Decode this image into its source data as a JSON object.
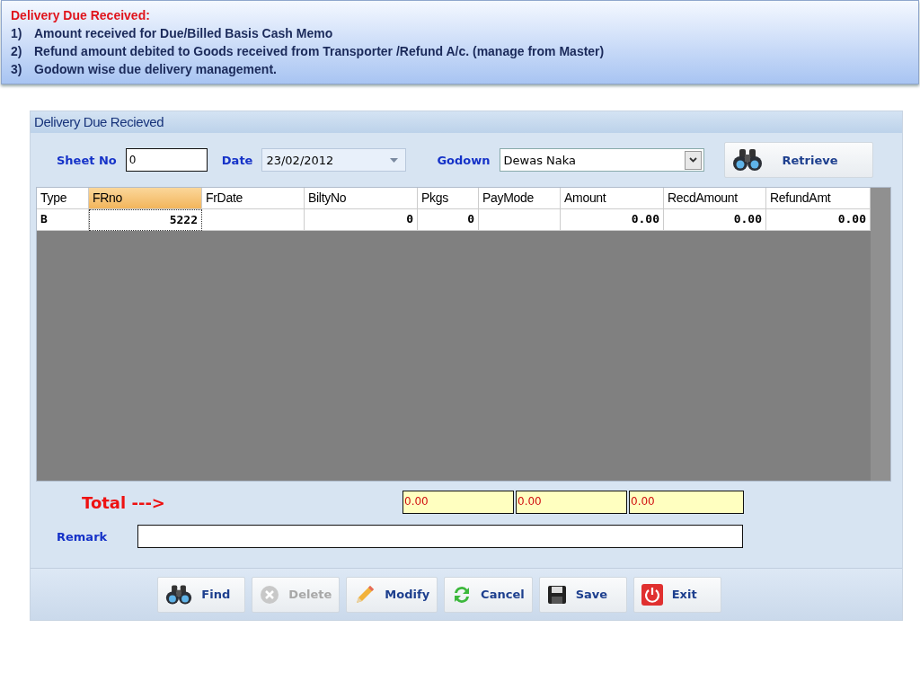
{
  "notes": {
    "title": "Delivery Due Received:",
    "items": [
      {
        "number": "1)",
        "text": "Amount received for Due/Billed Basis Cash Memo"
      },
      {
        "number": "2)",
        "text": "Refund amount debited to Goods received from Transporter /Refund A/c. (manage from Master)"
      },
      {
        "number": "3)",
        "text": "Godown wise  due delivery management."
      }
    ]
  },
  "window": {
    "title": "Delivery Due Recieved"
  },
  "form": {
    "sheet_no": {
      "label": "Sheet No",
      "value": "0"
    },
    "date": {
      "label": "Date",
      "value": "23/02/2012"
    },
    "godown": {
      "label": "Godown",
      "value": "Dewas Naka"
    },
    "retrieve_button": {
      "label": "Retrieve"
    }
  },
  "table": {
    "columns": [
      {
        "label": "Type",
        "selected": false
      },
      {
        "label": "FRno",
        "selected": true
      },
      {
        "label": "FrDate",
        "selected": false
      },
      {
        "label": "BiltyNo",
        "selected": false
      },
      {
        "label": "Pkgs",
        "selected": false
      },
      {
        "label": "PayMode",
        "selected": false
      },
      {
        "label": "Amount",
        "selected": false
      },
      {
        "label": "RecdAmount",
        "selected": false
      },
      {
        "label": "RefundAmt",
        "selected": false
      }
    ],
    "rows": [
      {
        "cells": [
          {
            "value": "B",
            "focused": false
          },
          {
            "value": "5222",
            "focused": true
          },
          {
            "focused": false
          },
          {
            "value": "0",
            "focused": false
          },
          {
            "value": "0",
            "focused": false
          },
          {
            "focused": false
          },
          {
            "value": "0.00",
            "focused": false
          },
          {
            "value": "0.00",
            "focused": false
          },
          {
            "value": "0.00",
            "focused": false
          }
        ]
      }
    ]
  },
  "totals": {
    "label": "Total --->",
    "values": [
      "0.00",
      "0.00",
      "0.00"
    ]
  },
  "remark": {
    "label": "Remark"
  },
  "toolbar": [
    {
      "label": "Find",
      "kind": "binoculars",
      "disabled": false
    },
    {
      "label": "Delete",
      "kind": "delete",
      "disabled": true
    },
    {
      "label": "Modify",
      "kind": "pencil",
      "disabled": false
    },
    {
      "label": "Cancel",
      "kind": "refresh",
      "disabled": false
    },
    {
      "label": "Save",
      "kind": "floppy",
      "disabled": false
    },
    {
      "label": "Exit",
      "kind": "power",
      "disabled": false
    }
  ]
}
